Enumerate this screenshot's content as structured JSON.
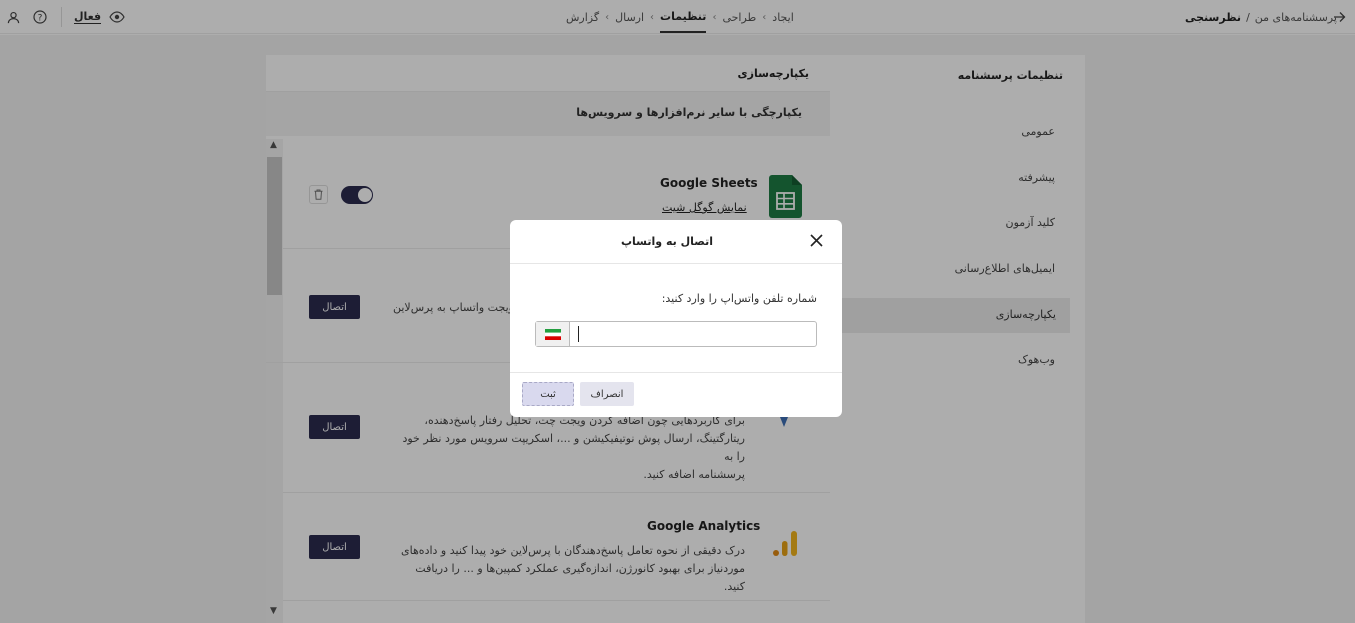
{
  "header": {
    "breadcrumb_root": "پرسشنامه‌های من",
    "breadcrumb_sep": "/",
    "breadcrumb_current": "نظرسنجی",
    "steps": [
      "ایجاد",
      "طراحی",
      "تنظیمات",
      "ارسال",
      "گزارش"
    ],
    "active_step": "تنظیمات",
    "status_label": "فعال"
  },
  "sidebar": {
    "title": "تنظیمات پرسشنامه",
    "items": [
      "عمومی",
      "پیشرفته",
      "کلید آزمون",
      "ایمیل‌های اطلاع‌رسانی",
      "یکپارچه‌سازی",
      "وب‌هوک"
    ],
    "active": "یکپارچه‌سازی"
  },
  "content": {
    "title": "یکپارچه‌سازی",
    "subtitle": "یکپارچگی با سایر نرم‌افزارها و سرویس‌ها",
    "sheets": {
      "name": "Google Sheets",
      "link": "نمایش گوگل شیت"
    },
    "whatsapp_text": "ویجت واتساپ به پرس‌لاین",
    "script_desc": [
      "برای کاربردهایی چون اضافه کردن ویجت چت، تحلیل رفتار پاسخ‌دهنده،",
      "ریتارگتینگ، ارسال پوش نوتیفیکیشن و ...، اسکریپت سرویس مورد نظر خود را به",
      "پرسشنامه اضافه کنید."
    ],
    "analytics": {
      "name": "Google Analytics",
      "desc": [
        "درک دقیقی از نحوه تعامل پاسخ‌دهندگان با پرس‌لاین خود پیدا کنید و داده‌های",
        "موردنیاز برای بهبود کانورژن، اندازه‌گیری عملکرد کمپین‌ها و ... را دریافت کنید."
      ]
    },
    "connect_label": "اتصال"
  },
  "modal": {
    "title": "اتصال به واتساپ",
    "prompt": "شماره تلفن واتس‌اپ را وارد کنید:",
    "phone_value": "",
    "submit_label": "ثبت",
    "cancel_label": "انصراف"
  },
  "colors": {
    "primary": "#2b2b4e",
    "sheets_green": "#1e7d45",
    "analytics_orange": "#e8a317",
    "overlay": "rgba(0,0,0,0.32)"
  }
}
